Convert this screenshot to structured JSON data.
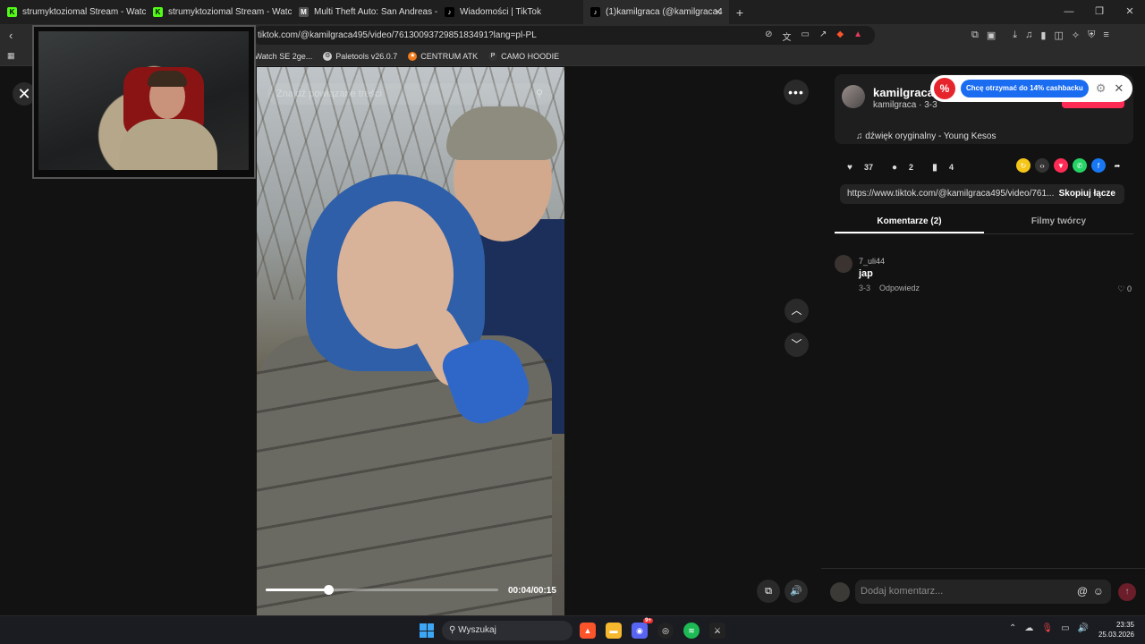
{
  "browser": {
    "tabs": [
      {
        "title": "strumyktoziomal Stream - Watch Live",
        "icon": "kick-icon",
        "color": "#53fc18"
      },
      {
        "title": "strumyktoziomal Stream - Watch Live",
        "icon": "kick-icon",
        "color": "#53fc18"
      },
      {
        "title": "Multi Theft Auto: San Andreas - Gran",
        "icon": "mta-icon",
        "color": "#333333"
      },
      {
        "title": "Wiadomości | TikTok",
        "icon": "tiktok-icon",
        "color": "#000000"
      },
      {
        "title": "(1)kamilgraca (@kamilgraca4",
        "icon": "tiktok-icon",
        "color": "#000000"
      }
    ],
    "url": "tiktok.com/@kamilgraca495/video/7613009372985183491?lang=pl-PL",
    "bookmarks": [
      "Watch SE 2ge...",
      "Paletools v26.0.7",
      "CENTRUM ATK",
      "CAMO HOODIE"
    ]
  },
  "video": {
    "search_placeholder": "Znajdź powiązane treści",
    "time": "00:04/00:15",
    "progress_fraction": 0.27
  },
  "panel": {
    "username": "kamilgraca",
    "subline": "kamilgraca · 3-3",
    "music": "dźwięk oryginalny - Young Kesos",
    "likes": "37",
    "comments": "2",
    "saves": "4",
    "link": "https://www.tiktok.com/@kamilgraca495/video/761...",
    "copy_label": "Skopiuj łącze",
    "tab_comments": "Komentarze (2)",
    "tab_videos": "Filmy twórcy",
    "comment": {
      "user": "7_uli44",
      "text": "jap",
      "date": "3-3",
      "reply": "Odpowiedz",
      "likes": "0"
    },
    "composer_placeholder": "Dodaj komentarz..."
  },
  "cashback": {
    "label": "Chcę otrzymać do 14% cashbacku"
  },
  "taskbar": {
    "search": "Wyszukaj",
    "time": "23:35",
    "date": "25.03.2026",
    "discord_badge": "9+"
  }
}
